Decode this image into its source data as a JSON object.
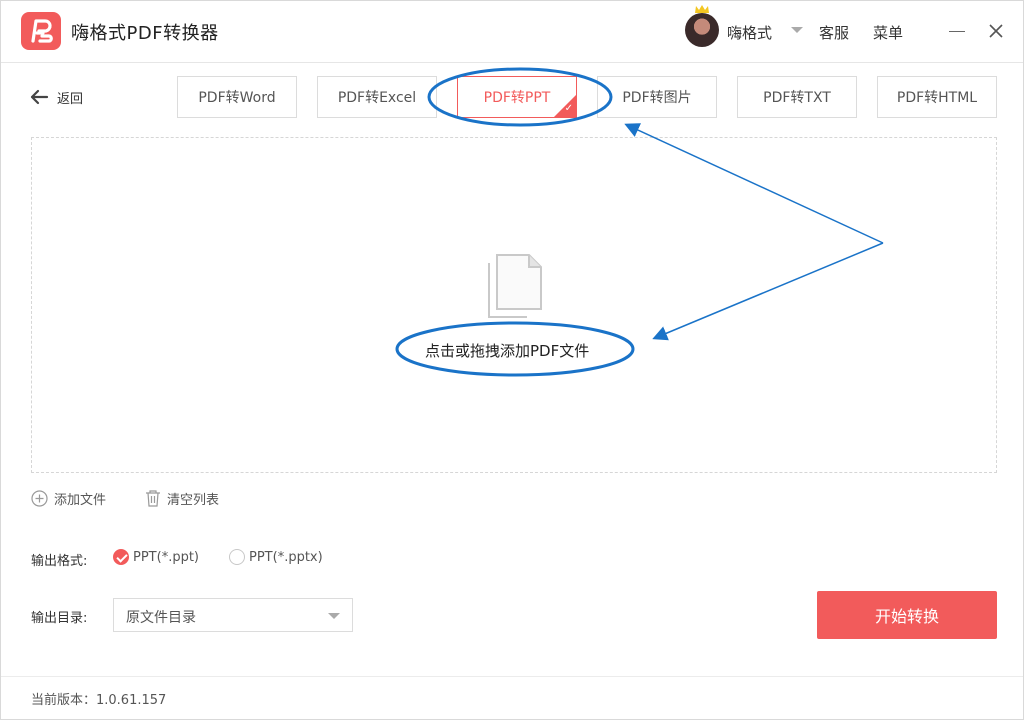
{
  "app": {
    "title": "嗨格式PDF转换器"
  },
  "header": {
    "username": "嗨格式",
    "service": "客服",
    "menu": "菜单"
  },
  "nav": {
    "back_label": "返回"
  },
  "tabs": [
    {
      "label": "PDF转Word",
      "active": false
    },
    {
      "label": "PDF转Excel",
      "active": false
    },
    {
      "label": "PDF转PPT",
      "active": true
    },
    {
      "label": "PDF转图片",
      "active": false
    },
    {
      "label": "PDF转TXT",
      "active": false
    },
    {
      "label": "PDF转HTML",
      "active": false
    }
  ],
  "dropzone": {
    "text": "点击或拖拽添加PDF文件"
  },
  "actions": {
    "add_file": "添加文件",
    "clear_list": "清空列表"
  },
  "output_format": {
    "label": "输出格式:",
    "options": [
      {
        "label": "PPT(*.ppt)",
        "checked": true
      },
      {
        "label": "PPT(*.pptx)",
        "checked": false
      }
    ]
  },
  "output_dir": {
    "label": "输出目录:",
    "value": "原文件目录"
  },
  "start_button": "开始转换",
  "footer": {
    "version": "当前版本：1.0.61.157"
  },
  "colors": {
    "accent": "#f25b5b",
    "annotation": "#1a73c8"
  }
}
